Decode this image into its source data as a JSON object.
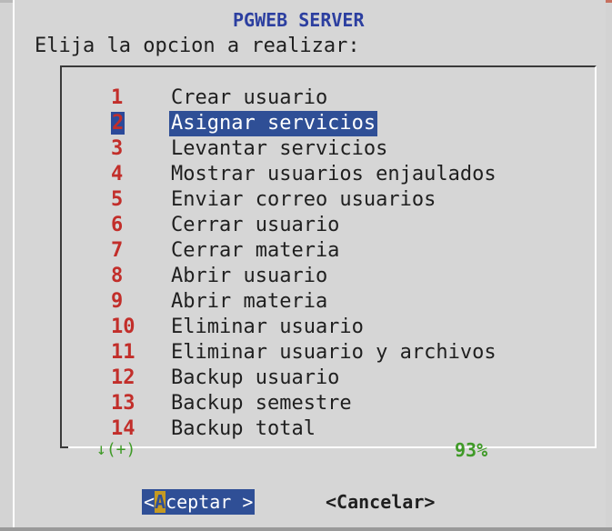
{
  "dialog": {
    "title": "PGWEB SERVER",
    "prompt": "Elija la opcion a realizar:"
  },
  "menu": {
    "selected_index": 1,
    "items": [
      {
        "key": "1",
        "label": "Crear usuario"
      },
      {
        "key": "2",
        "label": "Asignar servicios"
      },
      {
        "key": "3",
        "label": "Levantar servicios"
      },
      {
        "key": "4",
        "label": "Mostrar usuarios enjaulados"
      },
      {
        "key": "5",
        "label": "Enviar correo usuarios"
      },
      {
        "key": "6",
        "label": "Cerrar usuario"
      },
      {
        "key": "7",
        "label": "Cerrar materia"
      },
      {
        "key": "8",
        "label": "Abrir usuario"
      },
      {
        "key": "9",
        "label": "Abrir materia"
      },
      {
        "key": "10",
        "label": "Eliminar usuario"
      },
      {
        "key": "11",
        "label": "Eliminar usuario y archivos"
      },
      {
        "key": "12",
        "label": "Backup usuario"
      },
      {
        "key": "13",
        "label": "Backup semestre"
      },
      {
        "key": "14",
        "label": "Backup total"
      }
    ],
    "scroll_indicator": "↓(+)",
    "scroll_percent": "93%"
  },
  "buttons": {
    "accept_prefix": "<",
    "accept_hotkey": "A",
    "accept_rest": "ceptar >",
    "cancel_label": "<Cancelar>"
  },
  "colors": {
    "title": "#2c3fa0",
    "key": "#c22e2a",
    "selection_bg": "#2f4f96",
    "scroll": "#3f9a27",
    "background": "#d6d6d6"
  }
}
